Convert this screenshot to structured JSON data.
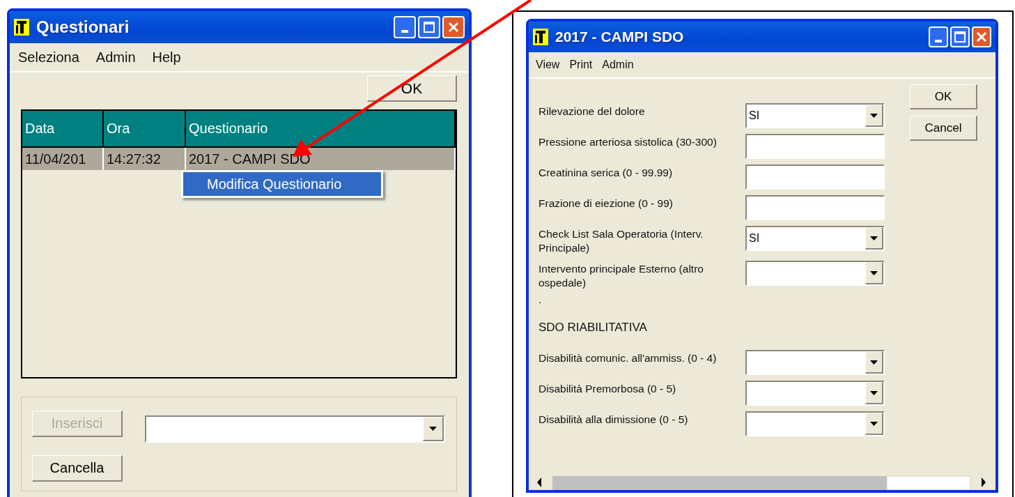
{
  "questionari_window": {
    "title": "Questionari",
    "menu": [
      "Seleziona",
      "Admin",
      "Help"
    ],
    "ok_button": "OK",
    "table": {
      "columns": [
        "Data",
        "Ora",
        "Questionario"
      ],
      "rows": [
        {
          "cells": [
            "11/04/201",
            "14:27:32",
            "2017 - CAMPI SDO"
          ],
          "selected": true
        }
      ]
    },
    "context_menu": {
      "items": [
        {
          "label": "Modifica Questionario",
          "selected": true
        }
      ]
    },
    "buttons": [
      {
        "label": "Inserisci",
        "disabled": true
      },
      {
        "label": "Cancella",
        "disabled": false
      }
    ]
  },
  "campi_window": {
    "title": "2017 - CAMPI SDO",
    "menu": [
      "View",
      "Print",
      "Admin"
    ],
    "buttons": [
      "OK",
      "Cancel"
    ],
    "fields": [
      {
        "label": "Rilevazione del dolore",
        "kind": "dropdown",
        "value": "SI"
      },
      {
        "label": "Pressione arteriosa sistolica (30-300)",
        "kind": "text"
      },
      {
        "label": "Creatinina serica (0 - 99.99)",
        "kind": "text"
      },
      {
        "label": "Frazione di eiezione (0 - 99)",
        "kind": "text"
      },
      {
        "label": "Check List Sala Operatoria (Interv. Principale)",
        "kind": "dropdown",
        "value": "SI"
      },
      {
        "label": "Intervento principale Esterno (altro ospedale)",
        "kind": "dropdown"
      }
    ],
    "note": ".",
    "section_title": "SDO RIABILITATIVA",
    "section_fields": [
      {
        "label": "Disabilità comunic. all'ammiss. (0 - 4)",
        "kind": "dropdown"
      },
      {
        "label": "Disabilità Premorbosa (0 - 5)",
        "kind": "dropdown"
      },
      {
        "label": "Disabilità alla dimissione (0 - 5)",
        "kind": "dropdown"
      }
    ]
  }
}
